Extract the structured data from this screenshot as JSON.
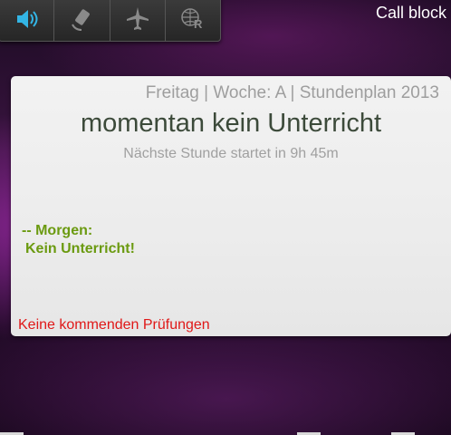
{
  "quick_settings": [
    {
      "name": "volume-icon"
    },
    {
      "name": "auto-rotate-icon"
    },
    {
      "name": "airplane-mode-icon"
    },
    {
      "name": "roaming-icon"
    }
  ],
  "app_title": "Call block",
  "widget": {
    "header": "Freitag | Woche: A | Stundenplan 2013",
    "status": "momentan kein Unterricht",
    "next_lesson": "Nächste Stunde startet in 9h 45m",
    "tomorrow_heading": "-- Morgen:",
    "tomorrow_text": "Kein Unterricht!",
    "exams": "Keine kommenden Prüfungen"
  },
  "colors": {
    "tomorrow": "#6b9a10",
    "exams": "#e01818",
    "status": "#3c4a3a",
    "muted": "#9e9e9e"
  }
}
